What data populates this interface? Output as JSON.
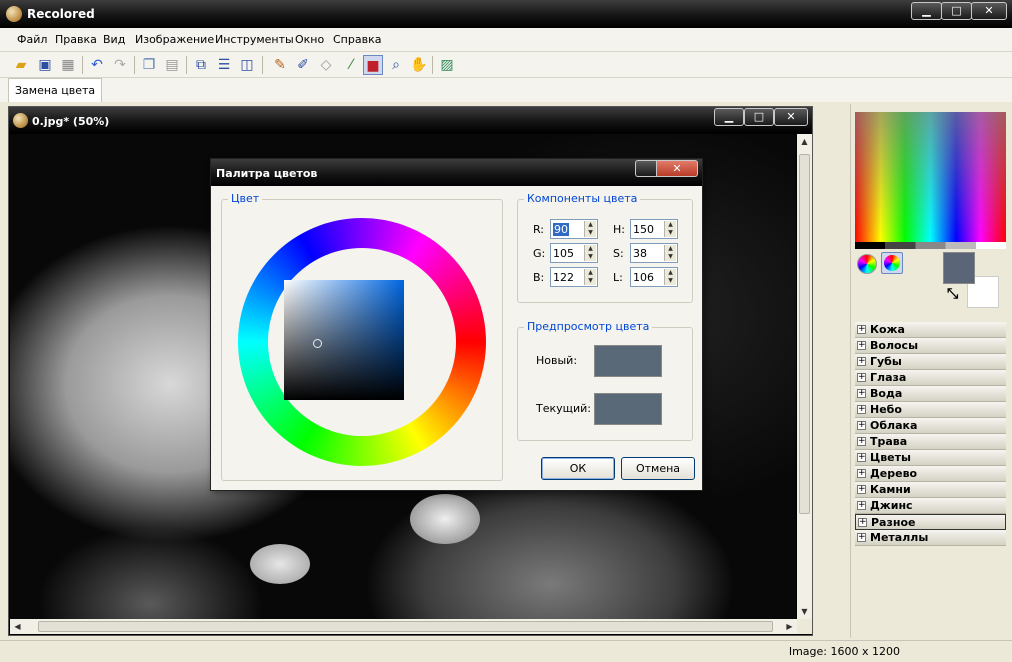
{
  "window": {
    "title": "Recolored",
    "minimize": "▁",
    "maximize": "□",
    "close": "✕"
  },
  "menu": {
    "items": [
      "Файл",
      "Правка",
      "Вид",
      "Изображение",
      "Инструменты",
      "Окно",
      "Справка"
    ]
  },
  "toolbar": {
    "icons": [
      "open-folder-icon",
      "save-icon",
      "print-icon",
      "undo-icon",
      "redo-icon",
      "copy-icon",
      "paste-icon",
      "layers-icon",
      "split-horizontal-icon",
      "split-vertical-icon",
      "brush-icon",
      "pen-icon",
      "eraser-icon",
      "eyedropper-icon",
      "recolor-icon",
      "magnifier-icon",
      "hand-icon",
      "image-icon"
    ]
  },
  "tabs": {
    "active": "Замена цвета"
  },
  "document": {
    "title": "0.jpg* (50%)",
    "minimize": "▁",
    "maximize": "□",
    "close": "✕"
  },
  "right_panel": {
    "current_color": "#5a6677",
    "categories": [
      "Кожа",
      "Волосы",
      "Губы",
      "Глаза",
      "Вода",
      "Небо",
      "Облака",
      "Трава",
      "Цветы",
      "Дерево",
      "Камни",
      "Джинс",
      "Разное",
      "Металлы"
    ],
    "selected_category": "Разное"
  },
  "status": {
    "image_info": "Image: 1600 x 1200"
  },
  "dialog": {
    "title": "Палитра цветов",
    "close": "✕",
    "color_group": "Цвет",
    "components_group": "Компоненты цвета",
    "components": {
      "R": {
        "label": "R:",
        "value": "90"
      },
      "G": {
        "label": "G:",
        "value": "105"
      },
      "B": {
        "label": "B:",
        "value": "122"
      },
      "H": {
        "label": "H:",
        "value": "150"
      },
      "S": {
        "label": "S:",
        "value": "38"
      },
      "L": {
        "label": "L:",
        "value": "106"
      }
    },
    "preview_group": "Предпросмотр цвета",
    "new_label": "Новый:",
    "current_label": "Текущий:",
    "new_color": "#5a6977",
    "current_color": "#5a6977",
    "ok": "ОК",
    "cancel": "Отмена"
  }
}
